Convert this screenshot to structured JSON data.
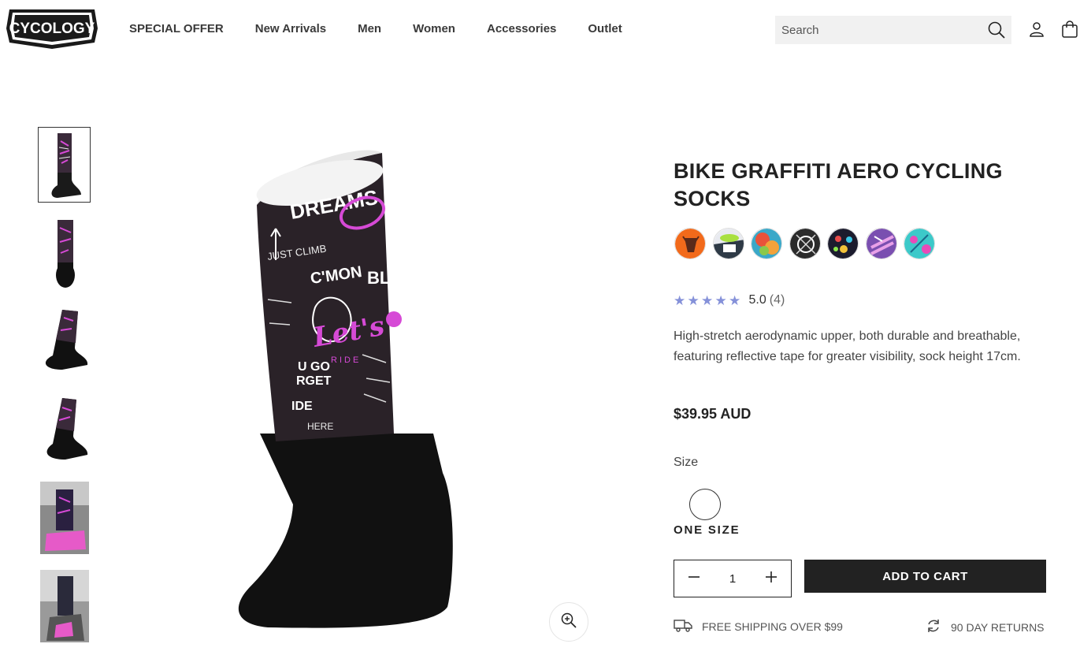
{
  "brand": {
    "logo_text": "CYCOLOGY"
  },
  "nav": {
    "items": [
      {
        "label": "SPECIAL OFFER"
      },
      {
        "label": "New Arrivals"
      },
      {
        "label": "Men"
      },
      {
        "label": "Women"
      },
      {
        "label": "Accessories"
      },
      {
        "label": "Outlet"
      }
    ]
  },
  "search": {
    "placeholder": "Search",
    "icon": "search-icon"
  },
  "header_icons": {
    "account": "account-icon",
    "cart": "cart-icon"
  },
  "gallery": {
    "thumbnail_count": 6,
    "active_index": 0,
    "zoom_icon": "zoom-in-icon"
  },
  "product": {
    "title": "BIKE GRAFFITI AERO CYCLING SOCKS",
    "variant_swatch_colors": [
      "#f26a1b",
      "#2e3a46",
      "#e8523a",
      "#2b2b2b",
      "#1c1c2e",
      "#7a4fb0",
      "#3cc9c9"
    ],
    "rating": {
      "score": "5.0",
      "count": "(4)",
      "stars": 5,
      "star_color": "#8591d9"
    },
    "description": "High-stretch aerodynamic upper, both durable and breathable, featuring reflective tape for greater visibility, sock height 17cm.",
    "price": "$39.95 AUD",
    "size": {
      "label": "Size",
      "selected": "ONE SIZE"
    },
    "quantity": "1",
    "add_to_cart_label": "ADD TO CART",
    "perks": [
      {
        "label": "FREE SHIPPING OVER $99",
        "icon": "truck-icon"
      },
      {
        "label": "90 DAY RETURNS",
        "icon": "returns-icon"
      }
    ]
  },
  "colors": {
    "accent": "#222222",
    "star": "#8591d9",
    "search_bg": "#f1f1f1"
  }
}
